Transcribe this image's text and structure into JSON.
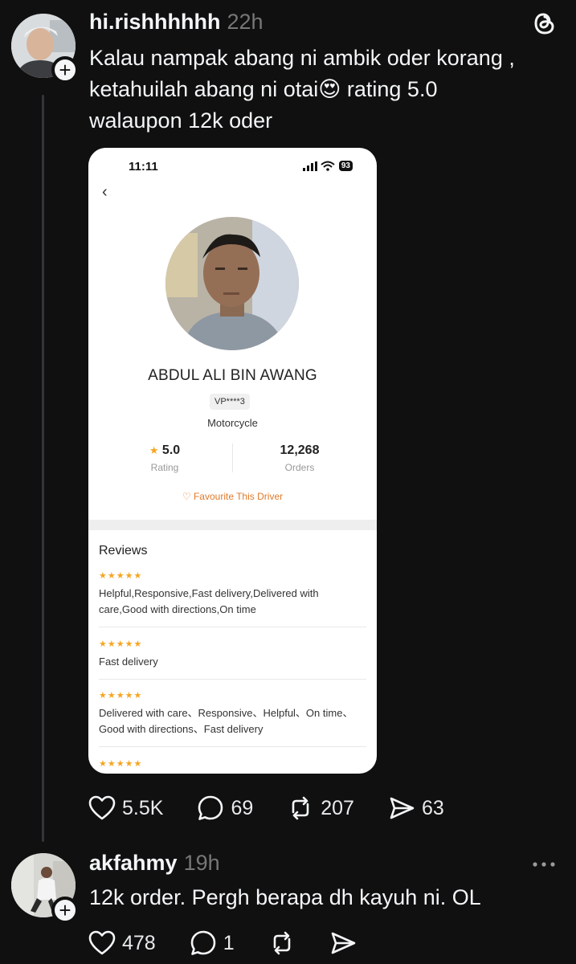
{
  "post": {
    "username": "hi.rishhhhhh",
    "time": "22h",
    "text_line1": "Kalau nampak abang ni ambik oder korang ,",
    "text_line2a": "ketahuilah abang ni otai",
    "emoji": "😍",
    "text_line2b": " rating 5.0",
    "text_line3": "walaupon 12k oder",
    "likes": "5.5K",
    "comments": "69",
    "reposts": "207",
    "shares": "63",
    "follow_icon": "plus-icon",
    "app_icon": "threads-logo-icon"
  },
  "screenshot": {
    "status_time": "11:11",
    "battery": "93",
    "driver_name": "ABDUL ALI BIN AWANG",
    "plate": "VP****3",
    "vehicle": "Motorcycle",
    "rating_value": "5.0",
    "rating_label": "Rating",
    "orders_value": "12,268",
    "orders_label": "Orders",
    "favourite": "♡ Favourite This Driver",
    "reviews_title": "Reviews",
    "stars": "★★★★★",
    "reviews": [
      "Helpful,Responsive,Fast delivery,Delivered with care,Good with directions,On time",
      "Fast delivery",
      "Delivered with care、Responsive、Helpful、On time、Good with directions、Fast delivery"
    ]
  },
  "reply": {
    "username": "akfahmy",
    "time": "19h",
    "text": "12k order. Pergh berapa dh kayuh ni. OL",
    "likes": "478",
    "comments": "1",
    "more_icon": "more-dots-icon"
  },
  "colors": {
    "background": "#101010",
    "text": "#f3f5f7",
    "muted": "#777777",
    "star": "#f5a623",
    "favourite": "#e07a2a"
  }
}
